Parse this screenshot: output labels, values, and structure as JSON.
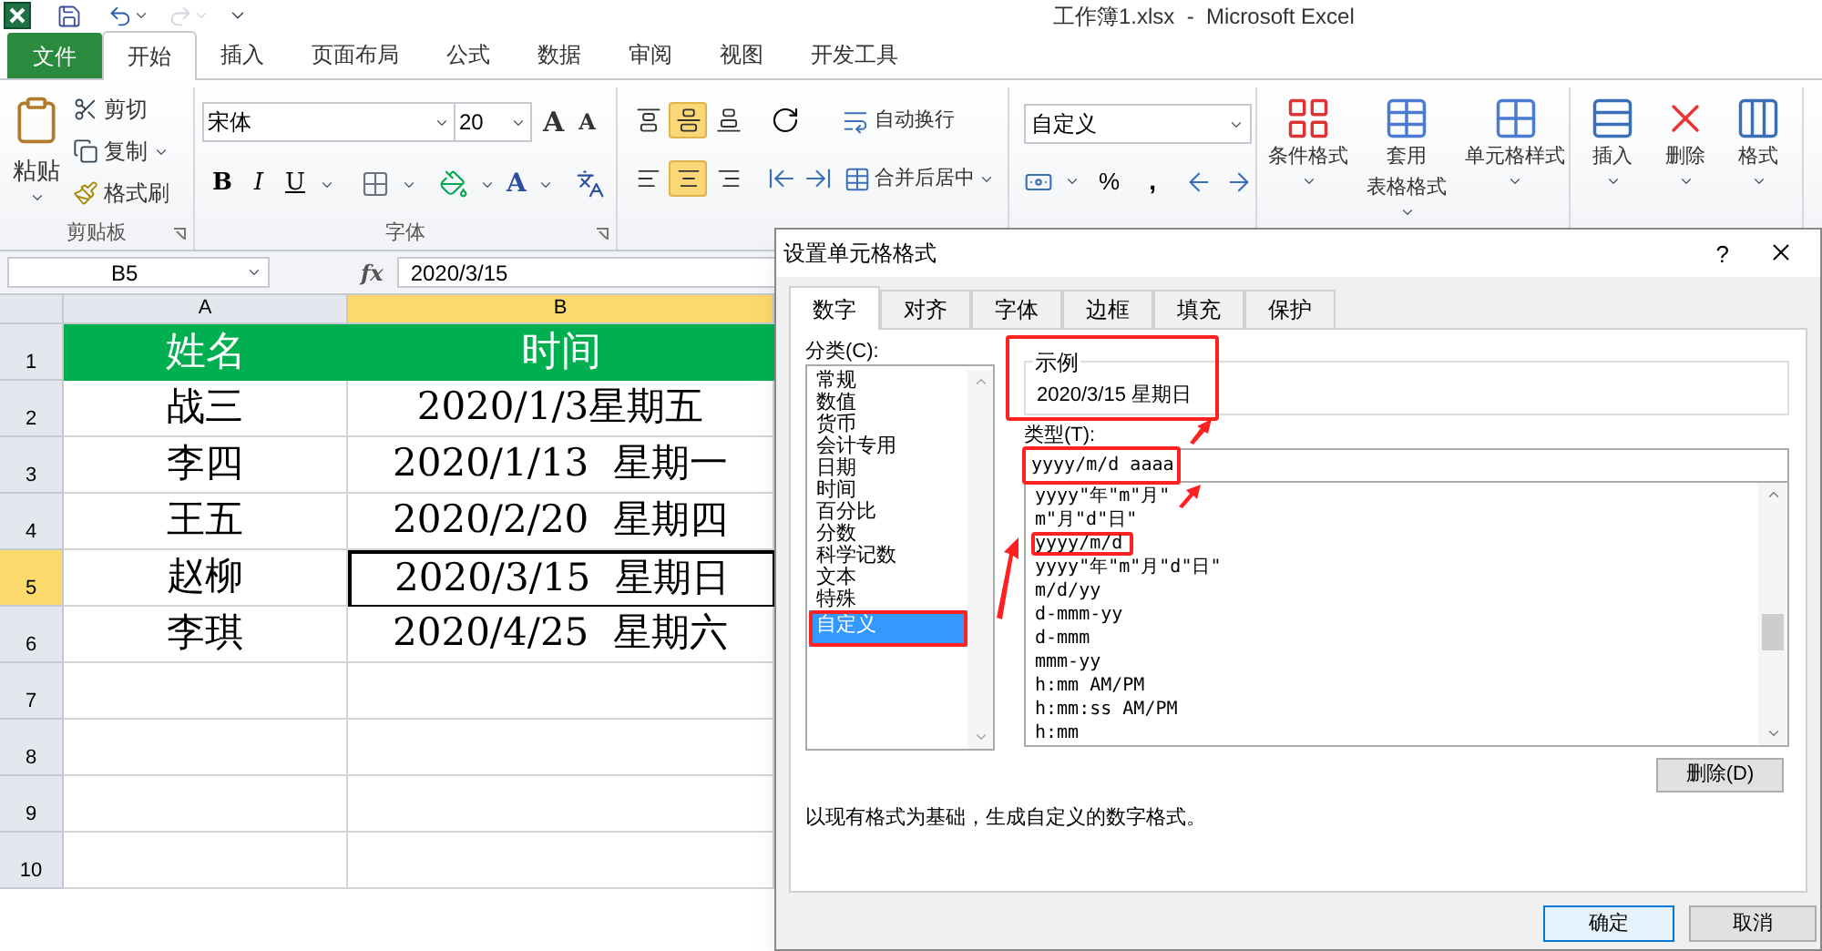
{
  "title_bar": {
    "title": "工作簿1.xlsx  -  Microsoft Excel"
  },
  "ribbon_tabs": [
    {
      "label": "文件",
      "kind": "file",
      "selected": false
    },
    {
      "label": "开始",
      "kind": "tab",
      "selected": true
    },
    {
      "label": "插入",
      "kind": "tab",
      "selected": false
    },
    {
      "label": "页面布局",
      "kind": "tab",
      "selected": false
    },
    {
      "label": "公式",
      "kind": "tab",
      "selected": false
    },
    {
      "label": "数据",
      "kind": "tab",
      "selected": false
    },
    {
      "label": "审阅",
      "kind": "tab",
      "selected": false
    },
    {
      "label": "视图",
      "kind": "tab",
      "selected": false
    },
    {
      "label": "开发工具",
      "kind": "tab",
      "selected": false
    }
  ],
  "clipboard": {
    "paste": "粘贴",
    "cut": "剪切",
    "copy": "复制",
    "format_painter": "格式刷",
    "group_label": "剪贴板"
  },
  "font": {
    "name": "宋体",
    "size": "20",
    "grow": "A",
    "shrink": "A",
    "bold": "B",
    "italic": "I",
    "underline": "U",
    "font_color": "A",
    "group_label": "字体"
  },
  "alignment": {
    "vertical": [
      {
        "selected": false
      },
      {
        "selected": true
      },
      {
        "selected": false
      }
    ],
    "horizontal": [
      {
        "selected": false
      },
      {
        "selected": true
      },
      {
        "selected": false
      }
    ],
    "wrap_text": "自动换行",
    "merge_center": "合并后居中"
  },
  "number": {
    "format": "自定义",
    "percent": "%",
    "comma": ","
  },
  "styles": [
    {
      "kind": "conditional",
      "lines": [
        "条件格式"
      ]
    },
    {
      "kind": "table",
      "lines": [
        "套用",
        "表格格式"
      ]
    },
    {
      "kind": "cell_style",
      "lines": [
        "单元格样式"
      ]
    }
  ],
  "cells": [
    {
      "kind": "insert",
      "lines": [
        "插入"
      ]
    },
    {
      "kind": "delete",
      "lines": [
        "删除"
      ]
    },
    {
      "kind": "format",
      "lines": [
        "格式"
      ]
    }
  ],
  "formula_bar": {
    "name_box": "B5",
    "function_label": "fx",
    "formula": "2020/3/15"
  },
  "sheet": {
    "columns": [
      {
        "label": "A",
        "selected": false
      },
      {
        "label": "B",
        "selected": true
      }
    ],
    "rows": [
      {
        "label": "1",
        "selected": false,
        "kind": "header",
        "cells": [
          {
            "text": "姓名",
            "active": false
          },
          {
            "text": "时间",
            "active": false
          }
        ]
      },
      {
        "label": "2",
        "selected": false,
        "kind": "data",
        "cells": [
          {
            "text": "战三",
            "active": false
          },
          {
            "text": "2020/1/3星期五",
            "active": false
          }
        ]
      },
      {
        "label": "3",
        "selected": false,
        "kind": "data",
        "cells": [
          {
            "text": "李四",
            "active": false
          },
          {
            "text": "2020/1/13  星期一",
            "active": false
          }
        ]
      },
      {
        "label": "4",
        "selected": false,
        "kind": "data",
        "cells": [
          {
            "text": "王五",
            "active": false
          },
          {
            "text": "2020/2/20  星期四",
            "active": false
          }
        ]
      },
      {
        "label": "5",
        "selected": true,
        "kind": "data",
        "cells": [
          {
            "text": "赵柳",
            "active": false
          },
          {
            "text": "2020/3/15  星期日",
            "active": true
          }
        ]
      },
      {
        "label": "6",
        "selected": false,
        "kind": "data",
        "cells": [
          {
            "text": "李琪",
            "active": false
          },
          {
            "text": "2020/4/25  星期六",
            "active": false
          }
        ]
      },
      {
        "label": "7",
        "selected": false,
        "kind": "empty"
      },
      {
        "label": "8",
        "selected": false,
        "kind": "empty"
      },
      {
        "label": "9",
        "selected": false,
        "kind": "empty"
      },
      {
        "label": "10",
        "selected": false,
        "kind": "empty"
      }
    ]
  },
  "dialog": {
    "title": "设置单元格格式",
    "help": "?",
    "tabs": [
      {
        "label": "数字",
        "selected": true
      },
      {
        "label": "对齐",
        "selected": false
      },
      {
        "label": "字体",
        "selected": false
      },
      {
        "label": "边框",
        "selected": false
      },
      {
        "label": "填充",
        "selected": false
      },
      {
        "label": "保护",
        "selected": false
      }
    ],
    "category_label": "分类(C):",
    "categories": [
      {
        "label": "常规",
        "selected": false
      },
      {
        "label": "数值",
        "selected": false
      },
      {
        "label": "货币",
        "selected": false
      },
      {
        "label": "会计专用",
        "selected": false
      },
      {
        "label": "日期",
        "selected": false
      },
      {
        "label": "时间",
        "selected": false
      },
      {
        "label": "百分比",
        "selected": false
      },
      {
        "label": "分数",
        "selected": false
      },
      {
        "label": "科学记数",
        "selected": false
      },
      {
        "label": "文本",
        "selected": false
      },
      {
        "label": "特殊",
        "selected": false
      },
      {
        "label": "自定义",
        "selected": true
      }
    ],
    "sample_label": "示例",
    "sample": "2020/3/15 星期日",
    "type_label": "类型(T):",
    "type_value": "yyyy/m/d aaaa",
    "formats": [
      {
        "text": "yyyy\"年\"m\"月\"",
        "highlighted": false
      },
      {
        "text": "m\"月\"d\"日\"",
        "highlighted": false
      },
      {
        "text": "yyyy/m/d",
        "highlighted": true
      },
      {
        "text": "yyyy\"年\"m\"月\"d\"日\"",
        "highlighted": false
      },
      {
        "text": "m/d/yy",
        "highlighted": false
      },
      {
        "text": "d-mmm-yy",
        "highlighted": false
      },
      {
        "text": "d-mmm",
        "highlighted": false
      },
      {
        "text": "mmm-yy",
        "highlighted": false
      },
      {
        "text": "h:mm AM/PM",
        "highlighted": false
      },
      {
        "text": "h:mm:ss AM/PM",
        "highlighted": false
      },
      {
        "text": "h:mm",
        "highlighted": false
      }
    ],
    "delete_button": "删除(D)",
    "description": "以现有格式为基础，生成自定义的数字格式。",
    "ok": "确定",
    "cancel": "取消"
  }
}
